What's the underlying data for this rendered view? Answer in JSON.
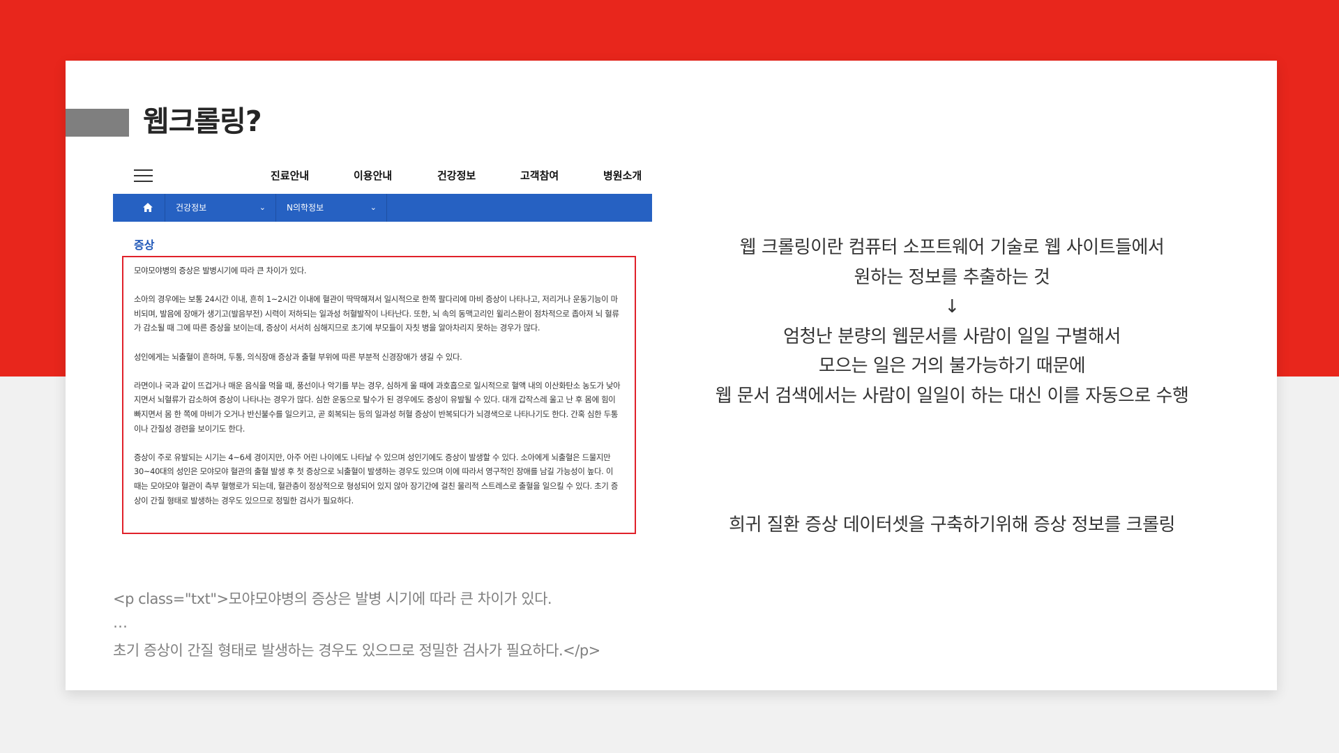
{
  "slide": {
    "title": "웹크롤링?"
  },
  "website": {
    "nav": [
      "진료안내",
      "이용안내",
      "건강정보",
      "고객참여",
      "병원소개"
    ],
    "breadcrumb": [
      {
        "label": "건강정보",
        "chevron": "⌄"
      },
      {
        "label": "N의학정보",
        "chevron": "⌄"
      }
    ],
    "section_title": "증상",
    "paragraphs": [
      "모야모야병의 증상은 발병시기에 따라 큰 차이가 있다.",
      "소아의 경우에는 보통 24시간 이내, 흔히 1~2시간 이내에 혈관이 딱딱해져서 일시적으로 한쪽 팔다리에 마비 증상이 나타나고, 저리거나 운동기능이 마비되며, 발음에 장애가 생기고(발음부전) 시력이 저하되는 일과성 허혈발작이 나타난다. 또한, 뇌 속의 동맥고리인 윌리스환이 점차적으로 좁아져 뇌 혈류가 감소될 때 그에 따른 증상을 보이는데, 증상이 서서히 심해지므로 초기에 부모들이 자칫 병을 알아차리지 못하는 경우가 많다.",
      "성인에게는 뇌출혈이 흔하며, 두통, 의식장애 증상과 출혈 부위에 따른 부분적 신경장애가 생길 수 있다.",
      "라면이나 국과 같이 뜨겁거나 매운 음식을 먹을 때, 풍선이나 악기를 부는 경우, 심하게 울 때에 과호흡으로 일시적으로 혈액 내의 이산화탄소 농도가 낮아지면서 뇌혈류가 감소하여 증상이 나타나는 경우가 많다. 심한 운동으로 탈수가 된 경우에도 증상이 유발될 수 있다. 대개 갑작스레 울고 난 후 몸에 힘이 빠지면서 몸 한 쪽에 마비가 오거나 반신불수를 일으키고, 곧 회복되는 등의 일과성 허혈 증상이 반복되다가 뇌경색으로 나타나기도 한다. 간혹 심한 두통이나 간질성 경련을 보이기도 한다.",
      "증상이 주로 유발되는 시기는 4~6세 경이지만, 아주 어린 나이에도 나타날 수 있으며 성인기에도 증상이 발생할 수 있다. 소아에게 뇌출혈은 드물지만 30~40대의 성인은 모야모야 혈관의 출혈 발생 후 첫 증상으로 뇌출혈이 발생하는 경우도 있으며 이에 따라서 영구적인 장애를 남길 가능성이 높다. 이 때는 모야모야 혈관이 측부 혈행로가 되는데, 혈관층이 정상적으로 형성되어 있지 않아 장기간에 걸친 물리적 스트레스로 출혈을 일으킬 수 있다. 초기 증상이 간질 형태로 발생하는 경우도 있으므로 정밀한 검사가 필요하다."
    ]
  },
  "explanation": {
    "lines": [
      "웹 크롤링이란 컴퓨터 소프트웨어 기술로 웹 사이트들에서",
      "원하는 정보를 추출하는 것",
      "↓",
      "엄청난 분량의 웹문서를 사람이 일일 구별해서",
      "모으는 일은 거의 불가능하기 때문에",
      "웹 문서 검색에서는 사람이 일일이 하는 대신 이를 자동으로 수행"
    ],
    "summary": "희귀 질환 증상 데이터셋을 구축하기위해 증상 정보를 크롤링"
  },
  "code_sample": {
    "line1": "<p class=\"txt\">모야모야병의 증상은 발병 시기에 따라 큰 차이가 있다.",
    "line2": "…",
    "line3": " 초기 증상이 간질 형태로 발생하는 경우도 있으므로 정밀한 검사가 필요하다.</p>"
  },
  "colors": {
    "accent_red": "#e8261c",
    "nav_blue": "#2661c2",
    "highlight_border": "#e0212a",
    "section_blue": "#2058b8"
  }
}
